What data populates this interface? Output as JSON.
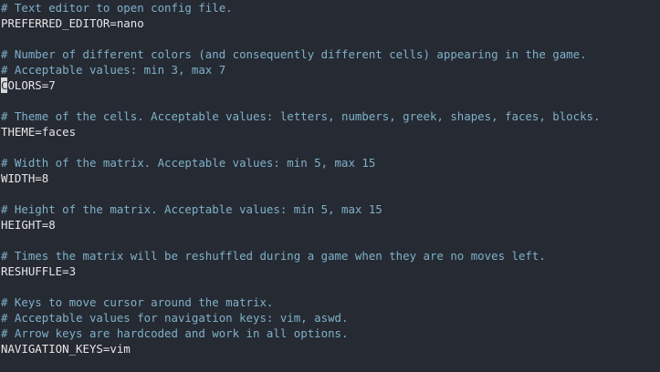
{
  "colors": {
    "background": "#262a33",
    "comment": "#7fb1c9",
    "setting": "#e6e6e6",
    "cursor": "#d8d8d8"
  },
  "editor": {
    "lines": [
      {
        "kind": "comment",
        "text": "# Text editor to open config file."
      },
      {
        "kind": "setting",
        "text": "PREFERRED_EDITOR=nano"
      },
      {
        "kind": "blank",
        "text": ""
      },
      {
        "kind": "comment",
        "text": "# Number of different colors (and consequently different cells) appearing in the game."
      },
      {
        "kind": "comment",
        "text": "# Acceptable values: min 3, max 7"
      },
      {
        "kind": "setting",
        "text": "COLORS=7",
        "cursor_char": "C",
        "rest": "OLORS=7"
      },
      {
        "kind": "blank",
        "text": ""
      },
      {
        "kind": "comment",
        "text": "# Theme of the cells. Acceptable values: letters, numbers, greek, shapes, faces, blocks."
      },
      {
        "kind": "setting",
        "text": "THEME=faces"
      },
      {
        "kind": "blank",
        "text": ""
      },
      {
        "kind": "comment",
        "text": "# Width of the matrix. Acceptable values: min 5, max 15"
      },
      {
        "kind": "setting",
        "text": "WIDTH=8"
      },
      {
        "kind": "blank",
        "text": ""
      },
      {
        "kind": "comment",
        "text": "# Height of the matrix. Acceptable values: min 5, max 15"
      },
      {
        "kind": "setting",
        "text": "HEIGHT=8"
      },
      {
        "kind": "blank",
        "text": ""
      },
      {
        "kind": "comment",
        "text": "# Times the matrix will be reshuffled during a game when they are no moves left."
      },
      {
        "kind": "setting",
        "text": "RESHUFFLE=3"
      },
      {
        "kind": "blank",
        "text": ""
      },
      {
        "kind": "comment",
        "text": "# Keys to move cursor around the matrix."
      },
      {
        "kind": "comment",
        "text": "# Acceptable values for navigation keys: vim, aswd."
      },
      {
        "kind": "comment",
        "text": "# Arrow keys are hardcoded and work in all options."
      },
      {
        "kind": "setting",
        "text": "NAVIGATION_KEYS=vim"
      },
      {
        "kind": "blank",
        "text": ""
      }
    ]
  }
}
